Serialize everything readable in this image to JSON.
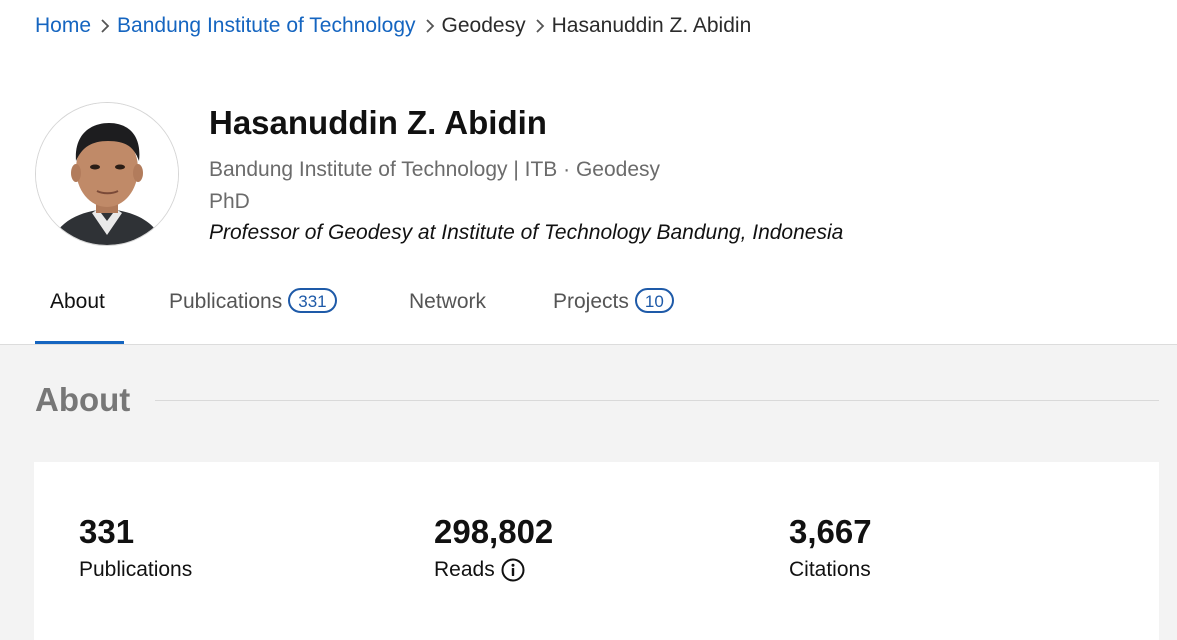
{
  "breadcrumb": {
    "items": [
      {
        "label": "Home",
        "link": true
      },
      {
        "label": "Bandung Institute of Technology",
        "link": true
      },
      {
        "label": "Geodesy",
        "link": false
      },
      {
        "label": "Hasanuddin Z. Abidin",
        "link": false
      }
    ],
    "separator_icon": "chevron-right-icon"
  },
  "profile": {
    "name": "Hasanuddin Z. Abidin",
    "affiliation": "Bandung Institute of Technology | ITB · Geodesy",
    "degree": "PhD",
    "position": "Professor of Geodesy at Institute of Technology Bandung, Indonesia",
    "avatar_icon": "profile-photo"
  },
  "tabs": [
    {
      "label": "About",
      "active": true
    },
    {
      "label": "Publications",
      "count": "331"
    },
    {
      "label": "Network"
    },
    {
      "label": "Projects",
      "count": "10"
    }
  ],
  "about": {
    "title": "About",
    "stats": [
      {
        "value": "331",
        "label": "Publications"
      },
      {
        "value": "298,802",
        "label": "Reads",
        "icon": "info-icon"
      },
      {
        "value": "3,667",
        "label": "Citations"
      }
    ]
  },
  "colors": {
    "link": "#1565c0",
    "accent": "#1e5aa8",
    "muted_text": "#6b6b6b",
    "section_bg": "#f3f3f3"
  }
}
